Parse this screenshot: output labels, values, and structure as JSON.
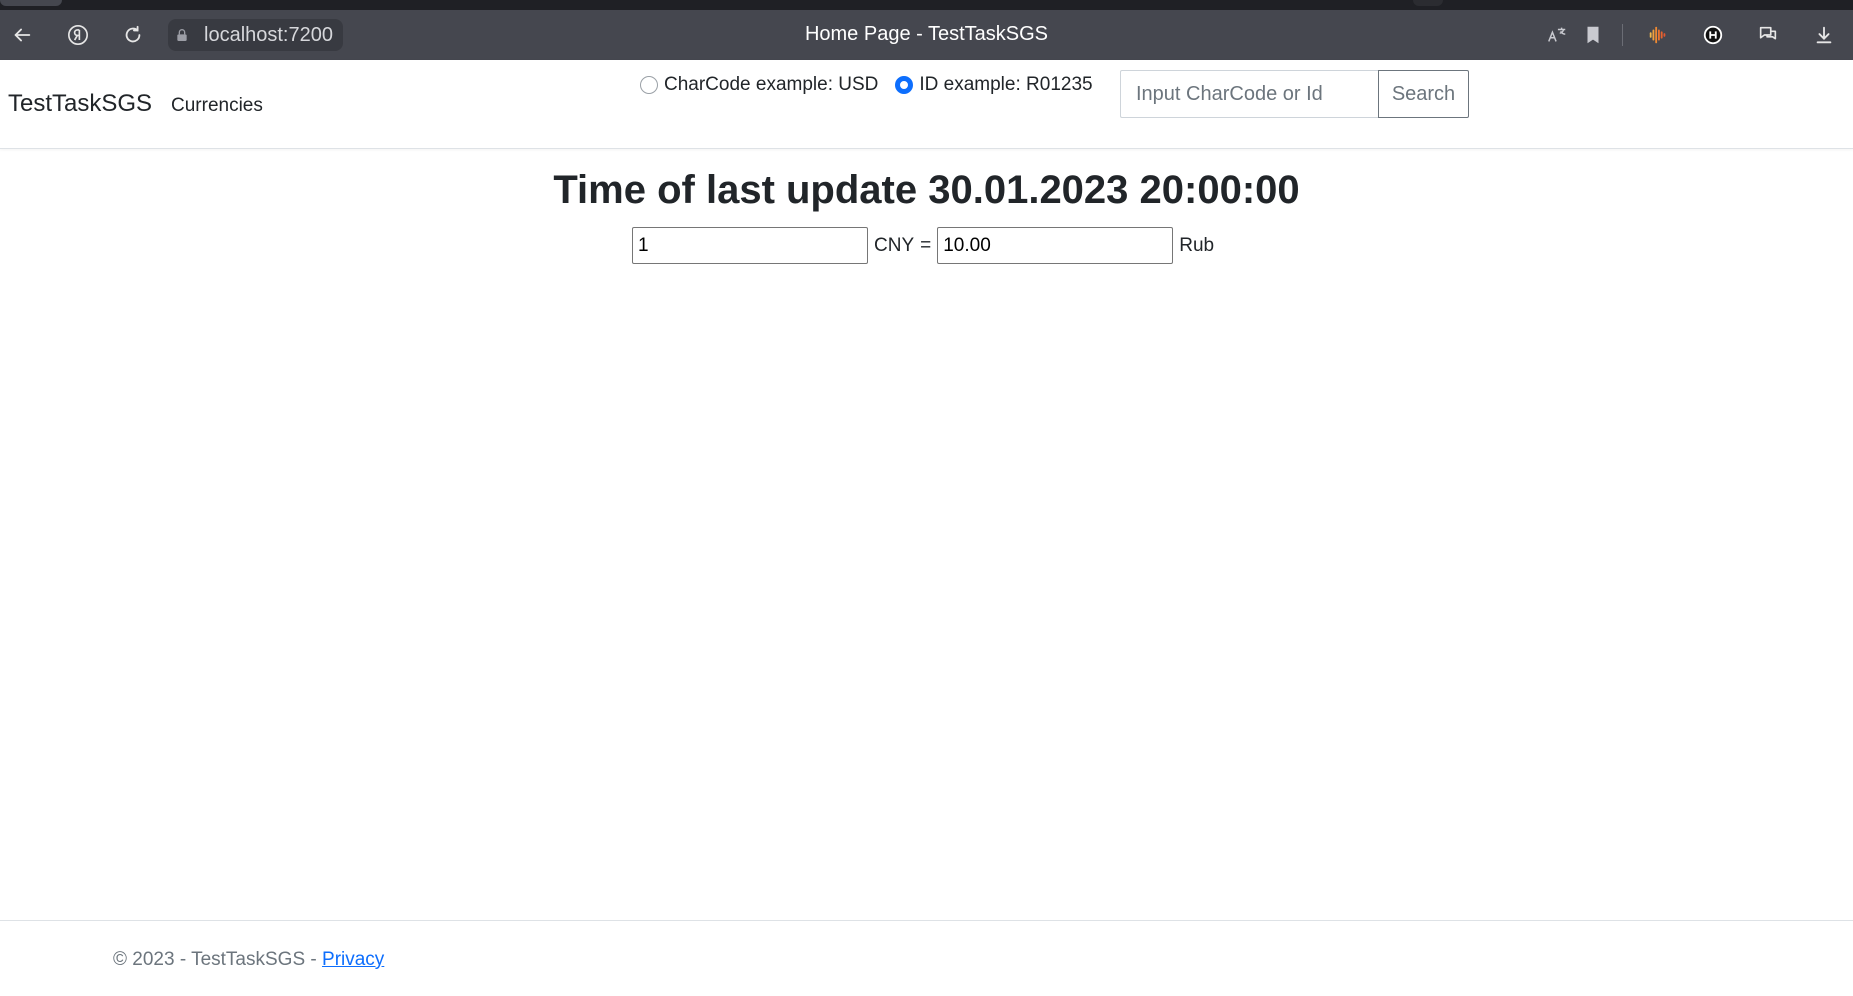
{
  "browser": {
    "url": "localhost:7200",
    "title": "Home Page - TestTaskSGS"
  },
  "navbar": {
    "brand": "TestTaskSGS",
    "links": [
      "Currencies"
    ]
  },
  "search": {
    "options": [
      {
        "label": "CharCode example: USD",
        "checked": false
      },
      {
        "label": "ID example: R01235",
        "checked": true
      }
    ],
    "placeholder": "Input CharCode or Id",
    "button_label": "Search"
  },
  "main": {
    "heading": "Time of last update 30.01.2023 20:00:00",
    "amount_value": "1",
    "currency_code": "CNY",
    "equals": "=",
    "rub_value": "10.00",
    "rub_label": "Rub"
  },
  "footer": {
    "text": "© 2023 - TestTaskSGS - ",
    "privacy_link": "Privacy"
  },
  "colors": {
    "browser_bar": "#45474f",
    "accent": "#0d6efd",
    "text": "#212529",
    "muted": "#6c757d"
  }
}
